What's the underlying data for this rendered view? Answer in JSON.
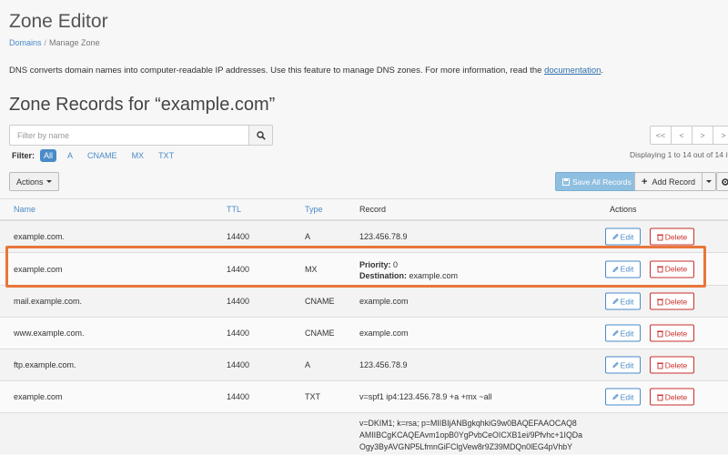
{
  "page": {
    "title": "Zone Editor",
    "breadcrumb": {
      "root": "Domains",
      "separator": "/",
      "current": "Manage Zone"
    },
    "description": {
      "text": "DNS converts domain names into computer-readable IP addresses. Use this feature to manage DNS zones. For more information, read the ",
      "link": "documentation",
      "suffix": "."
    },
    "section_title": "Zone Records for “example.com”"
  },
  "search": {
    "placeholder": "Filter by name",
    "value": "",
    "icon": "search-icon"
  },
  "filter": {
    "label": "Filter:",
    "options": [
      "All",
      "A",
      "CNAME",
      "MX",
      "TXT"
    ],
    "active": "All"
  },
  "pagination": {
    "buttons": [
      "<<",
      "<",
      ">",
      ">"
    ],
    "displaying": "Displaying 1 to 14 out of 14 it"
  },
  "toolbar": {
    "actions_label": "Actions",
    "save_all_label": "Save All Records",
    "add_record_label": "Add Record",
    "settings_icon": "gear-icon"
  },
  "table": {
    "headers": {
      "name": "Name",
      "ttl": "TTL",
      "type": "Type",
      "record": "Record",
      "actions": "Actions"
    },
    "edit_label": "Edit",
    "delete_label": "Delete",
    "rows": [
      {
        "name": "example.com.",
        "ttl": "14400",
        "type": "A",
        "record": "123.456.78.9"
      },
      {
        "name": "example.com",
        "ttl": "14400",
        "type": "MX",
        "priority_label": "Priority:",
        "priority": "0",
        "destination_label": "Destination:",
        "destination": "example.com"
      },
      {
        "name": "mail.example.com.",
        "ttl": "14400",
        "type": "CNAME",
        "record": "example.com"
      },
      {
        "name": "www.example.com.",
        "ttl": "14400",
        "type": "CNAME",
        "record": "example.com"
      },
      {
        "name": "ftp.example.com.",
        "ttl": "14400",
        "type": "A",
        "record": "123.456.78.9"
      },
      {
        "name": "example.com",
        "ttl": "14400",
        "type": "TXT",
        "record": "v=spf1 ip4:123.456.78.9 +a +mx ~all"
      }
    ],
    "partial_row": {
      "lines": [
        "v=DKIM1; k=rsa; p=MIIBIjANBgkqhkiG9w0BAQEFAAOCAQ8",
        "AMIIBCgKCAQEAvm1opB0YgPvbCeOICXB1ei/9Pfvhc+1IQDa",
        "Ogy3ByAVGNP5LfmnGiFClgVew8r9Z39MDQn0lEG4pVhbY"
      ]
    }
  },
  "colors": {
    "link": "#4a8bc8",
    "danger": "#c9302c",
    "highlight": "#e8763a",
    "primary_disabled": "#8fbfe0"
  }
}
